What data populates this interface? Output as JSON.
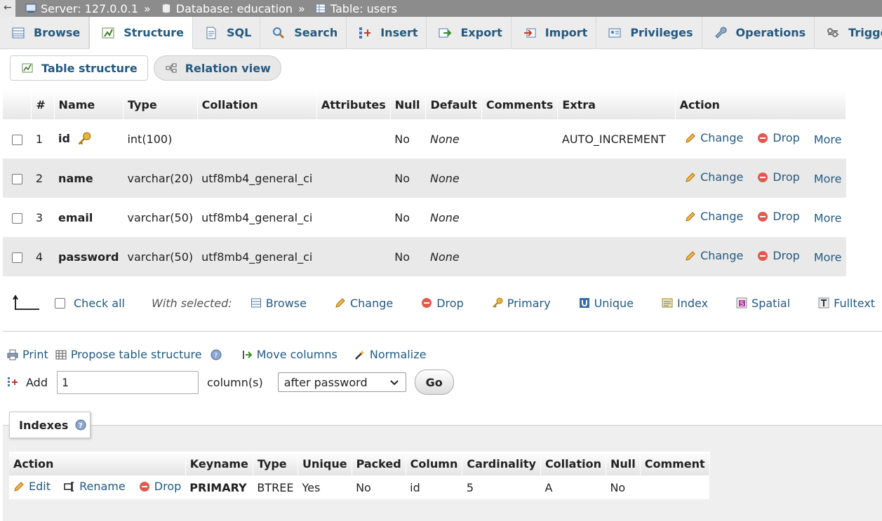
{
  "breadcrumb": {
    "back": "←",
    "server": "Server: 127.0.0.1",
    "database": "Database: education",
    "table": "Table: users",
    "separator": "»"
  },
  "tabs": [
    {
      "label": "Browse",
      "icon": "browse-icon"
    },
    {
      "label": "Structure",
      "icon": "structure-icon",
      "active": true
    },
    {
      "label": "SQL",
      "icon": "sql-icon"
    },
    {
      "label": "Search",
      "icon": "search-icon"
    },
    {
      "label": "Insert",
      "icon": "insert-icon"
    },
    {
      "label": "Export",
      "icon": "export-icon"
    },
    {
      "label": "Import",
      "icon": "import-icon"
    },
    {
      "label": "Privileges",
      "icon": "privileges-icon"
    },
    {
      "label": "Operations",
      "icon": "wrench-icon"
    },
    {
      "label": "Triggers",
      "icon": "triggers-icon"
    }
  ],
  "subtabs": {
    "table_structure": "Table structure",
    "relation_view": "Relation view"
  },
  "structure": {
    "headers": {
      "num": "#",
      "name": "Name",
      "type": "Type",
      "collation": "Collation",
      "attributes": "Attributes",
      "null": "Null",
      "default": "Default",
      "comments": "Comments",
      "extra": "Extra",
      "action": "Action"
    },
    "rows": [
      {
        "num": "1",
        "name": "id",
        "type": "int(100)",
        "collation": "",
        "attributes": "",
        "null": "No",
        "default": "None",
        "comments": "",
        "extra": "AUTO_INCREMENT"
      },
      {
        "num": "2",
        "name": "name",
        "type": "varchar(20)",
        "collation": "utf8mb4_general_ci",
        "attributes": "",
        "null": "No",
        "default": "None",
        "comments": "",
        "extra": ""
      },
      {
        "num": "3",
        "name": "email",
        "type": "varchar(50)",
        "collation": "utf8mb4_general_ci",
        "attributes": "",
        "null": "No",
        "default": "None",
        "comments": "",
        "extra": ""
      },
      {
        "num": "4",
        "name": "password",
        "type": "varchar(50)",
        "collation": "utf8mb4_general_ci",
        "attributes": "",
        "null": "No",
        "default": "None",
        "comments": "",
        "extra": ""
      }
    ],
    "actions": {
      "change": "Change",
      "drop": "Drop",
      "more": "More"
    }
  },
  "with_selected": {
    "check_all": "Check all",
    "label": "With selected:",
    "browse": "Browse",
    "change": "Change",
    "drop": "Drop",
    "primary": "Primary",
    "unique": "Unique",
    "index": "Index",
    "spatial": "Spatial",
    "fulltext": "Fulltext"
  },
  "tools": {
    "print": "Print",
    "propose": "Propose table structure",
    "move_columns": "Move columns",
    "normalize": "Normalize"
  },
  "add_columns": {
    "add_label": "Add",
    "count_value": "1",
    "columns_label": "column(s)",
    "position_value": "after password",
    "go": "Go"
  },
  "indexes": {
    "title": "Indexes",
    "headers": {
      "action": "Action",
      "keyname": "Keyname",
      "type": "Type",
      "unique": "Unique",
      "packed": "Packed",
      "column": "Column",
      "cardinality": "Cardinality",
      "collation": "Collation",
      "null": "Null",
      "comment": "Comment"
    },
    "row": {
      "edit": "Edit",
      "rename": "Rename",
      "drop": "Drop",
      "keyname": "PRIMARY",
      "type": "BTREE",
      "unique": "Yes",
      "packed": "No",
      "column": "id",
      "cardinality": "5",
      "collation": "A",
      "null": "No",
      "comment": ""
    }
  }
}
